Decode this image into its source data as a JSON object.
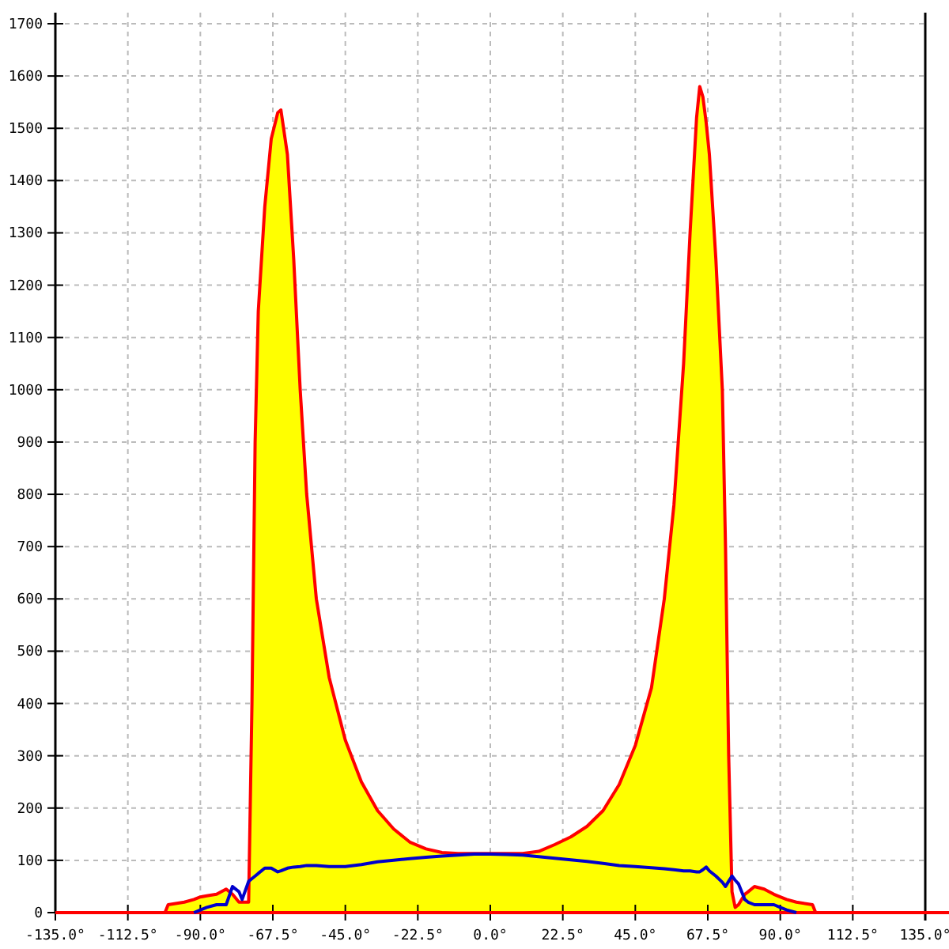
{
  "chart_data": {
    "type": "area",
    "x": [
      -135,
      -101,
      -100,
      -95,
      -92,
      -90,
      -88,
      -85,
      -82,
      -80,
      -78,
      -77,
      -75,
      -74,
      -73,
      -72,
      -70,
      -68,
      -66,
      -65,
      -63,
      -61,
      -59,
      -57,
      -54,
      -50,
      -45,
      -40,
      -35,
      -30,
      -25,
      -20,
      -15,
      -10,
      -5,
      0,
      5,
      10,
      15,
      20,
      25,
      30,
      35,
      40,
      45,
      50,
      54,
      57,
      60,
      62,
      64,
      65,
      66,
      67,
      68,
      70,
      72,
      73,
      74,
      75,
      76,
      77,
      79,
      80,
      82,
      85,
      88,
      90,
      92,
      95,
      100,
      101,
      135
    ],
    "series": [
      {
        "type": "area",
        "color": "#ff0000",
        "values": [
          0,
          0,
          15,
          20,
          25,
          30,
          32,
          35,
          45,
          35,
          20,
          20,
          20,
          400,
          900,
          1150,
          1350,
          1480,
          1530,
          1535,
          1450,
          1250,
          1000,
          800,
          600,
          450,
          330,
          250,
          195,
          160,
          135,
          122,
          115,
          113,
          113,
          113,
          113,
          113,
          117,
          130,
          145,
          165,
          195,
          245,
          320,
          430,
          600,
          780,
          1050,
          1300,
          1520,
          1580,
          1560,
          1510,
          1450,
          1250,
          1000,
          700,
          300,
          40,
          10,
          15,
          35,
          40,
          50,
          45,
          35,
          30,
          25,
          20,
          15,
          0,
          0
        ]
      },
      {
        "type": "line",
        "color": "#0000cc",
        "values": [
          null,
          null,
          null,
          null,
          0,
          5,
          10,
          15,
          15,
          50,
          40,
          25,
          60,
          65,
          70,
          75,
          85,
          85,
          78,
          80,
          85,
          87,
          88,
          90,
          90,
          88,
          88,
          92,
          97,
          100,
          103,
          106,
          108,
          110,
          112,
          112,
          111,
          110,
          107,
          104,
          101,
          98,
          94,
          90,
          88,
          86,
          84,
          82,
          80,
          80,
          78,
          78,
          82,
          87,
          80,
          70,
          58,
          50,
          60,
          70,
          62,
          55,
          25,
          20,
          15,
          15,
          15,
          10,
          5,
          0,
          null,
          null,
          null
        ]
      }
    ],
    "grid": true,
    "xlim": [
      -135,
      135
    ],
    "ylim": [
      0,
      1700
    ],
    "xticks": [
      {
        "value": -135,
        "label": "-135.0°"
      },
      {
        "value": -112.5,
        "label": "-112.5°"
      },
      {
        "value": -90,
        "label": "-90.0°"
      },
      {
        "value": -67.5,
        "label": "-67.5°"
      },
      {
        "value": -45,
        "label": "-45.0°"
      },
      {
        "value": -22.5,
        "label": "-22.5°"
      },
      {
        "value": 0,
        "label": "0.0°"
      },
      {
        "value": 22.5,
        "label": "22.5°"
      },
      {
        "value": 45,
        "label": "45.0°"
      },
      {
        "value": 67.5,
        "label": "67.5°"
      },
      {
        "value": 90,
        "label": "90.0°"
      },
      {
        "value": 112.5,
        "label": "112.5°"
      },
      {
        "value": 135,
        "label": "135.0°"
      }
    ],
    "yticks": [
      0,
      100,
      200,
      300,
      400,
      500,
      600,
      700,
      800,
      900,
      1000,
      1100,
      1200,
      1300,
      1400,
      1500,
      1600,
      1700
    ]
  }
}
